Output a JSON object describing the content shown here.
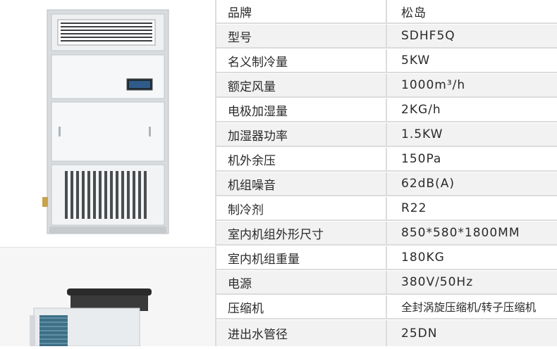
{
  "specs": [
    {
      "label": "品牌",
      "value": "松岛"
    },
    {
      "label": "型号",
      "value": "SDHF5Q"
    },
    {
      "label": "名义制冷量",
      "value": "5KW"
    },
    {
      "label": "额定风量",
      "value": "1000m³/h"
    },
    {
      "label": "电极加湿量",
      "value": "2KG/h"
    },
    {
      "label": "加湿器功率",
      "value": "1.5KW"
    },
    {
      "label": "机外余压",
      "value": "150Pa"
    },
    {
      "label": "机组噪音",
      "value": "62dB(A)"
    },
    {
      "label": "制冷剂",
      "value": "R22"
    },
    {
      "label": "室内机组外形尺寸",
      "value": "850*580*1800MM"
    },
    {
      "label": "室内机组重量",
      "value": "180KG"
    },
    {
      "label": "电源",
      "value": "380V/50Hz"
    },
    {
      "label": "压缩机",
      "value": "全封涡旋压缩机/转子压缩机"
    },
    {
      "label": "进出水管径",
      "value": "25DN"
    }
  ],
  "colors": {
    "row_alt": "#f2f2f2",
    "border": "#dcdcdc",
    "text": "#2a2a2a",
    "display_screen": "#2e5b8a"
  },
  "icons": [
    "indoor-unit-image",
    "outdoor-unit-image",
    "control-display-icon"
  ]
}
